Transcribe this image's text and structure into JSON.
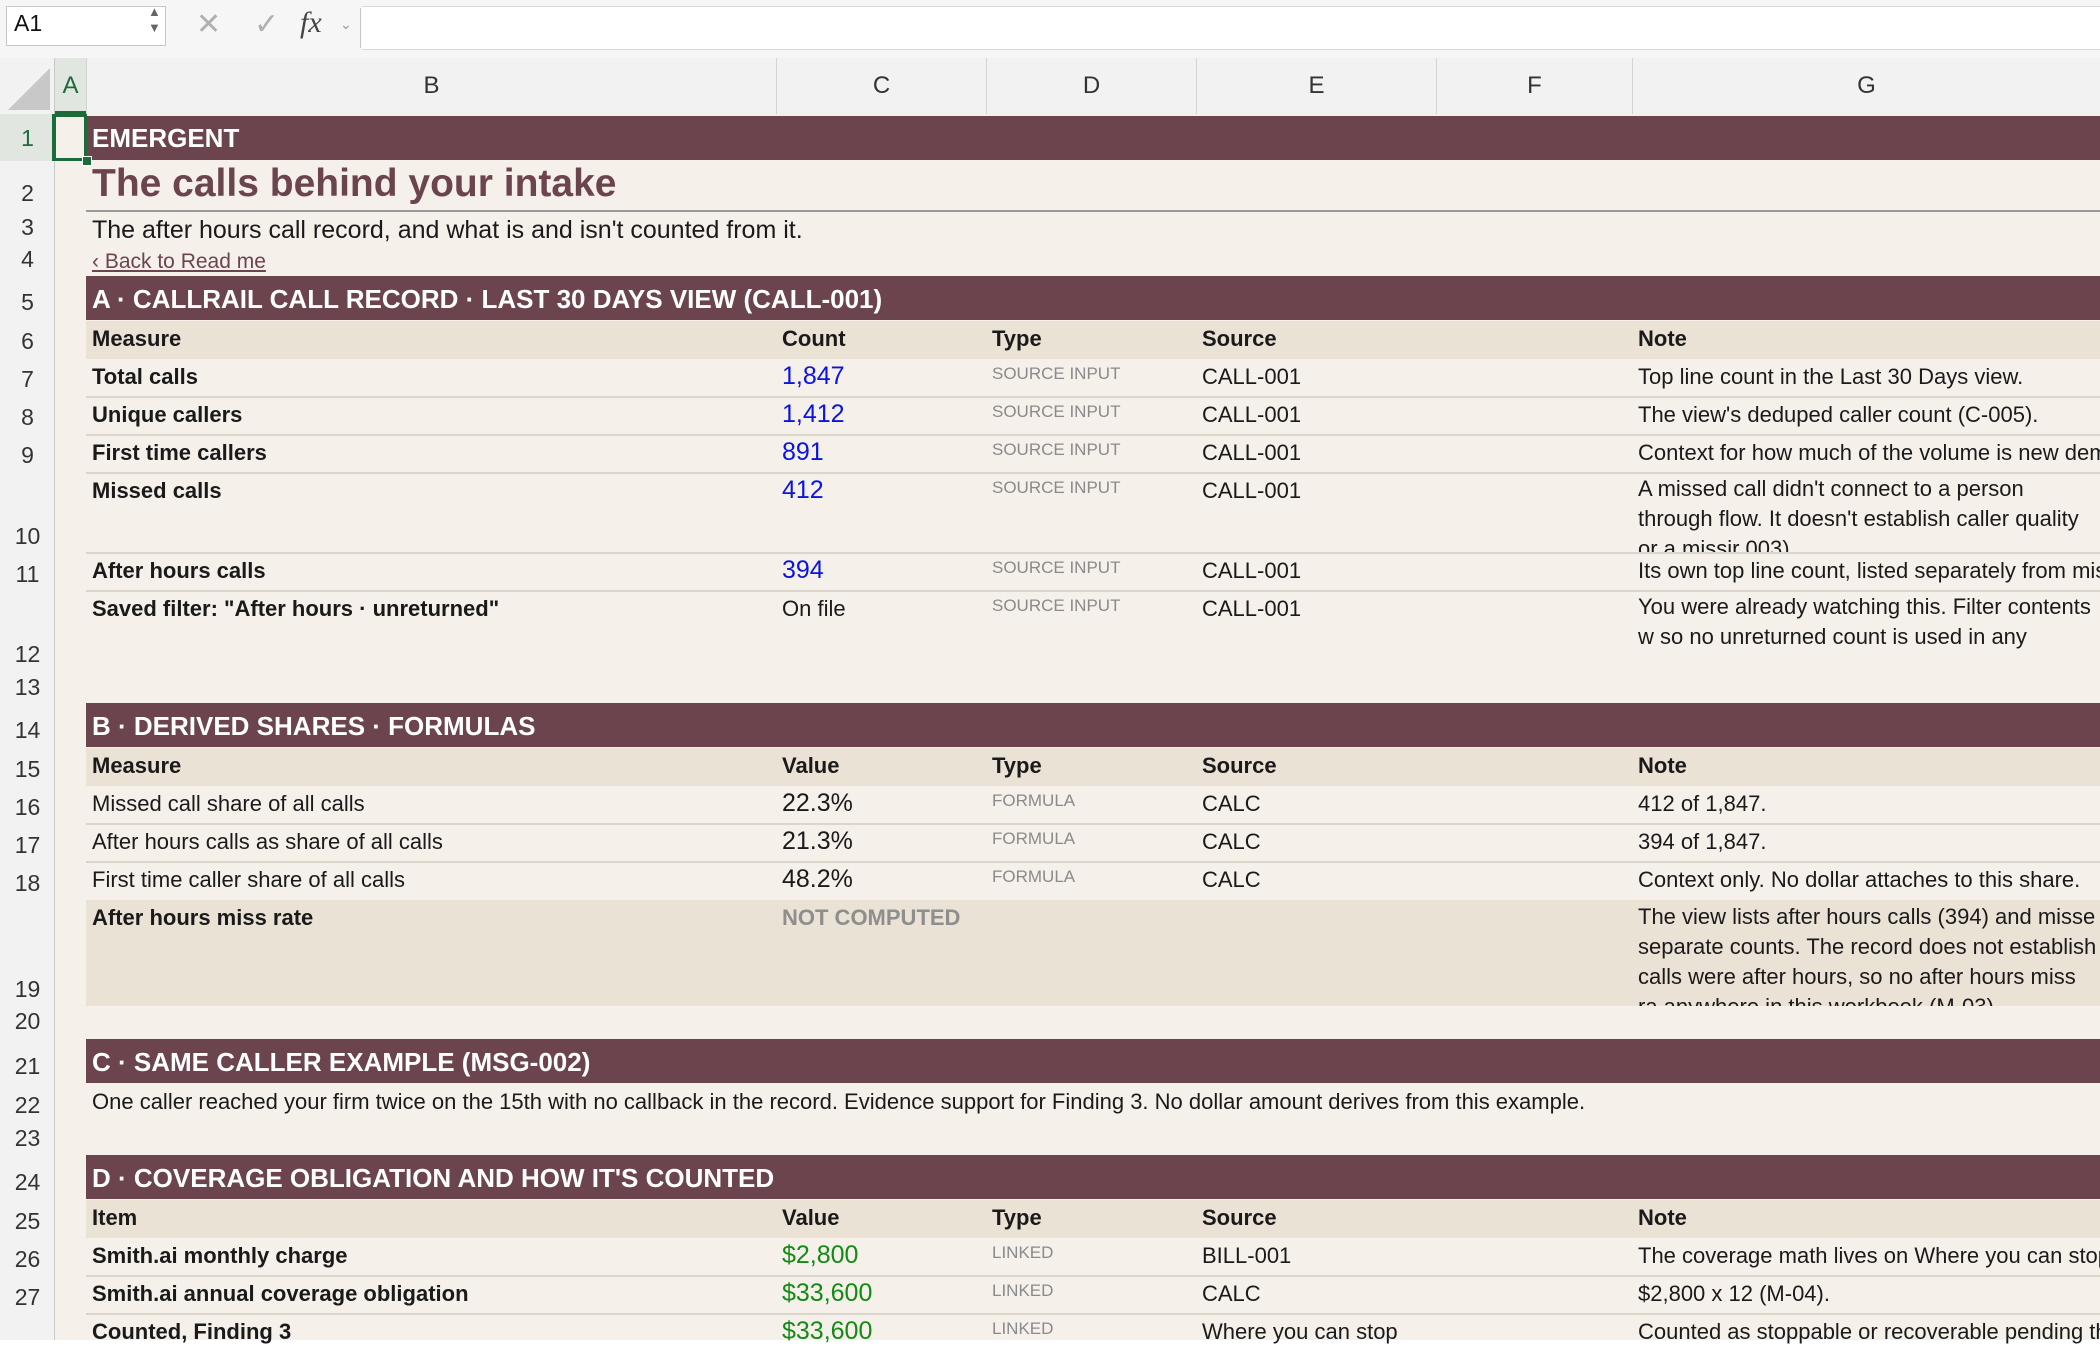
{
  "formula_bar": {
    "name_box": "A1",
    "fx_label": "fx",
    "formula": ""
  },
  "columns": [
    "A",
    "B",
    "C",
    "D",
    "E",
    "F",
    "G"
  ],
  "rows": [
    "1",
    "2",
    "3",
    "4",
    "5",
    "6",
    "7",
    "8",
    "9",
    "10",
    "11",
    "12",
    "13",
    "14",
    "15",
    "16",
    "17",
    "18",
    "19",
    "20",
    "21",
    "22",
    "23",
    "24",
    "25",
    "26",
    "27"
  ],
  "header": {
    "brand": "EMERGENT",
    "title": "The calls behind your intake",
    "subtitle": "The after hours call record, and what is and isn't counted from it.",
    "back_link": "‹ Back to Read me"
  },
  "section_a": {
    "title": "A  ·  CALLRAIL CALL RECORD  ·  LAST 30 DAYS VIEW (CALL-001)",
    "headers": [
      "Measure",
      "Count",
      "Type",
      "Source",
      "Note"
    ],
    "rows": [
      {
        "measure": "Total calls",
        "count": "1,847",
        "type": "SOURCE INPUT",
        "source": "CALL-001",
        "note": "Top line count in the Last 30 Days view."
      },
      {
        "measure": "Unique callers",
        "count": "1,412",
        "type": "SOURCE INPUT",
        "source": "CALL-001",
        "note": "The view's deduped caller count (C-005)."
      },
      {
        "measure": "First time callers",
        "count": "891",
        "type": "SOURCE INPUT",
        "source": "CALL-001",
        "note": "Context for how much of the volume is new dem"
      },
      {
        "measure": "Missed calls",
        "count": "412",
        "type": "SOURCE INPUT",
        "source": "CALL-001",
        "note": "A missed call didn't connect to a person through flow. It doesn't establish caller quality or a missir 003)."
      },
      {
        "measure": "After hours calls",
        "count": "394",
        "type": "SOURCE INPUT",
        "source": "CALL-001",
        "note": "Its own top line count, listed separately from mis"
      },
      {
        "measure": "Saved filter: \"After hours · unreturned\"",
        "count": "On file",
        "type": "SOURCE INPUT",
        "source": "CALL-001",
        "note": "You were already watching this. Filter contents w so no unreturned count is used in any calculatio"
      }
    ]
  },
  "section_b": {
    "title": "B  ·  DERIVED SHARES  ·  FORMULAS",
    "headers": [
      "Measure",
      "Value",
      "Type",
      "Source",
      "Note"
    ],
    "rows": [
      {
        "measure": "Missed call share of all calls",
        "value": "22.3%",
        "type": "FORMULA",
        "source": "CALC",
        "note": "412 of 1,847."
      },
      {
        "measure": "After hours calls as share of all calls",
        "value": "21.3%",
        "type": "FORMULA",
        "source": "CALC",
        "note": "394 of 1,847."
      },
      {
        "measure": "First time caller share of all calls",
        "value": "48.2%",
        "type": "FORMULA",
        "source": "CALC",
        "note": "Context only. No dollar attaches to this share."
      }
    ],
    "miss_rate": {
      "measure": "After hours miss rate",
      "value": "NOT COMPUTED",
      "note": "The view lists after hours calls (394) and misse separate counts. The record does not establish calls were after hours, so no after hours miss ra anywhere in this workbook (M-03)."
    }
  },
  "section_c": {
    "title": "C  ·  SAME CALLER EXAMPLE (MSG-002)",
    "text": "One caller reached your firm twice on the 15th with no callback in the record. Evidence support for Finding 3. No dollar amount derives from this example."
  },
  "section_d": {
    "title": "D  ·  COVERAGE OBLIGATION AND HOW IT'S COUNTED",
    "headers": [
      "Item",
      "Value",
      "Type",
      "Source",
      "Note"
    ],
    "rows": [
      {
        "item": "Smith.ai monthly charge",
        "value": "$2,800",
        "type": "LINKED",
        "source": "BILL-001",
        "note": "The coverage math lives on Where you can stop"
      },
      {
        "item": "Smith.ai annual coverage obligation",
        "value": "$33,600",
        "type": "LINKED",
        "source": "CALC",
        "note": "$2,800 x 12 (M-04)."
      },
      {
        "item": "Counted, Finding 3",
        "value": "$33,600",
        "type": "LINKED",
        "source": "Where you can stop",
        "note": "Counted as stoppable or recoverable pending th"
      }
    ]
  },
  "colors": {
    "band": "#6b444e",
    "title": "#6b444e",
    "input_blue": "#0a14e0",
    "linked_green": "#138a14",
    "sheet_bg": "#f5f0ea"
  }
}
